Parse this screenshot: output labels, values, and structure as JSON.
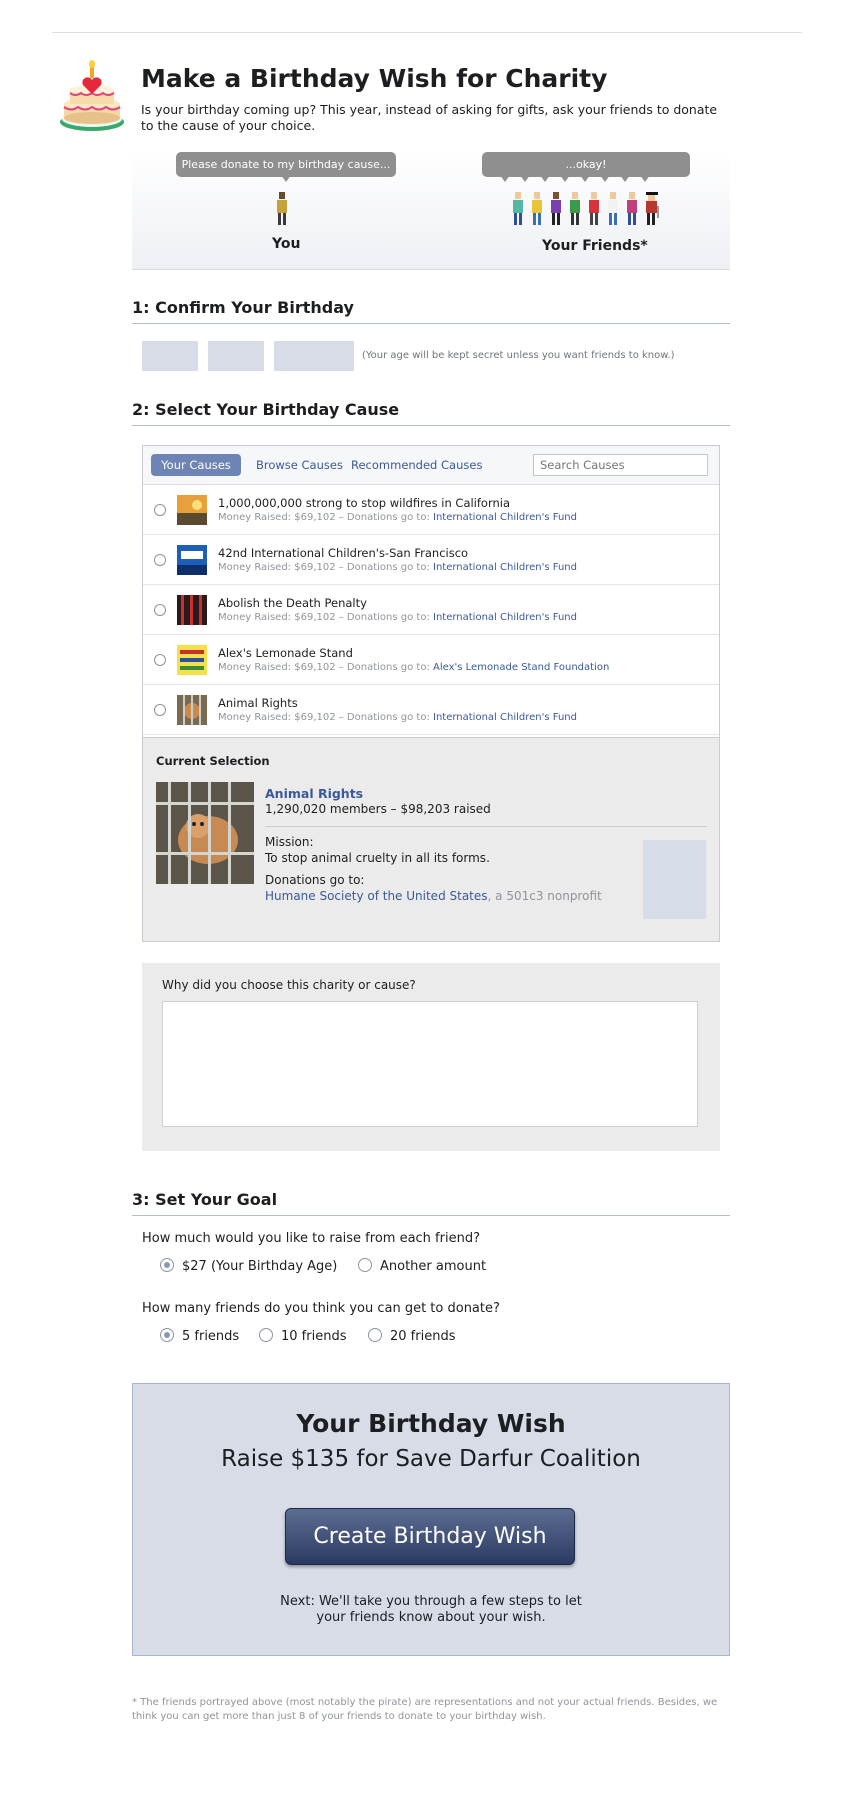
{
  "header": {
    "title": "Make a Birthday Wish for Charity",
    "intro": "Is your birthday coming up? This year, instead of asking for gifts, ask your friends to donate to the cause of your choice."
  },
  "illustration": {
    "you_bubble": "Please donate to my birthday cause...",
    "friends_bubble": "...okay!",
    "you_caption": "You",
    "friends_caption": "Your Friends*"
  },
  "step1": {
    "heading": "1: Confirm Your Birthday",
    "age_note": "(Your age will be kept secret unless you want friends to know.)"
  },
  "step2": {
    "heading": "2: Select Your Birthday Cause",
    "tabs": [
      "Your Causes",
      "Browse Causes",
      "Recommended Causes"
    ],
    "search_placeholder": "Search Causes",
    "causes": [
      {
        "name": "1,000,000,000 strong to stop wildfires in California",
        "meta": "Money Raised: $69,102 – Donations go to: ",
        "org": "International Children's Fund"
      },
      {
        "name": "42nd International Children's-San Francisco",
        "meta": "Money Raised: $69,102 – Donations go to: ",
        "org": "International Children's Fund"
      },
      {
        "name": "Abolish the Death Penalty",
        "meta": "Money Raised: $69,102 – Donations go to: ",
        "org": "International Children's Fund"
      },
      {
        "name": "Alex's Lemonade Stand",
        "meta": "Money Raised: $69,102 – Donations go to: ",
        "org": "Alex's Lemonade Stand Foundation"
      },
      {
        "name": "Animal Rights",
        "meta": "Money Raised: $69,102 – Donations go to: ",
        "org": "International Children's Fund"
      }
    ],
    "current_selection": {
      "label": "Current Selection",
      "name": "Animal Rights",
      "stats": "1,290,020 members – $98,203 raised",
      "mission_label": "Mission:",
      "mission": "To stop animal cruelty in all its forms.",
      "donations_label": "Donations go to:",
      "org": "Humane Society of the United States",
      "org_type": ", a 501c3 nonprofit"
    },
    "why_label": "Why did you choose this charity or cause?"
  },
  "step3": {
    "heading": "3: Set Your Goal",
    "q1": "How much would you like to raise from each friend?",
    "q1_options": [
      "$27 (Your Birthday Age)",
      "Another amount"
    ],
    "q1_selected": 0,
    "q2": "How many friends do you think you can get to donate?",
    "q2_options": [
      "5 friends",
      "10 friends",
      "20 friends"
    ],
    "q2_selected": 0
  },
  "wish": {
    "title": "Your Birthday Wish",
    "subtitle": "Raise $135 for Save Darfur Coalition",
    "button": "Create Birthday Wish",
    "next_line1": "Next: We'll take you through a few steps to let",
    "next_line2": "your friends know about your wish."
  },
  "footnote": "* The friends portrayed above (most notably the pirate) are representations and not your actual friends. Besides, we think you can get more than just 8 of your friends to donate to your birthday wish.",
  "colors": {
    "link": "#3b5998",
    "tab_active": "#6d84b4",
    "wish_bg": "#d7dce7",
    "placeholder_box": "#d7dce7"
  }
}
